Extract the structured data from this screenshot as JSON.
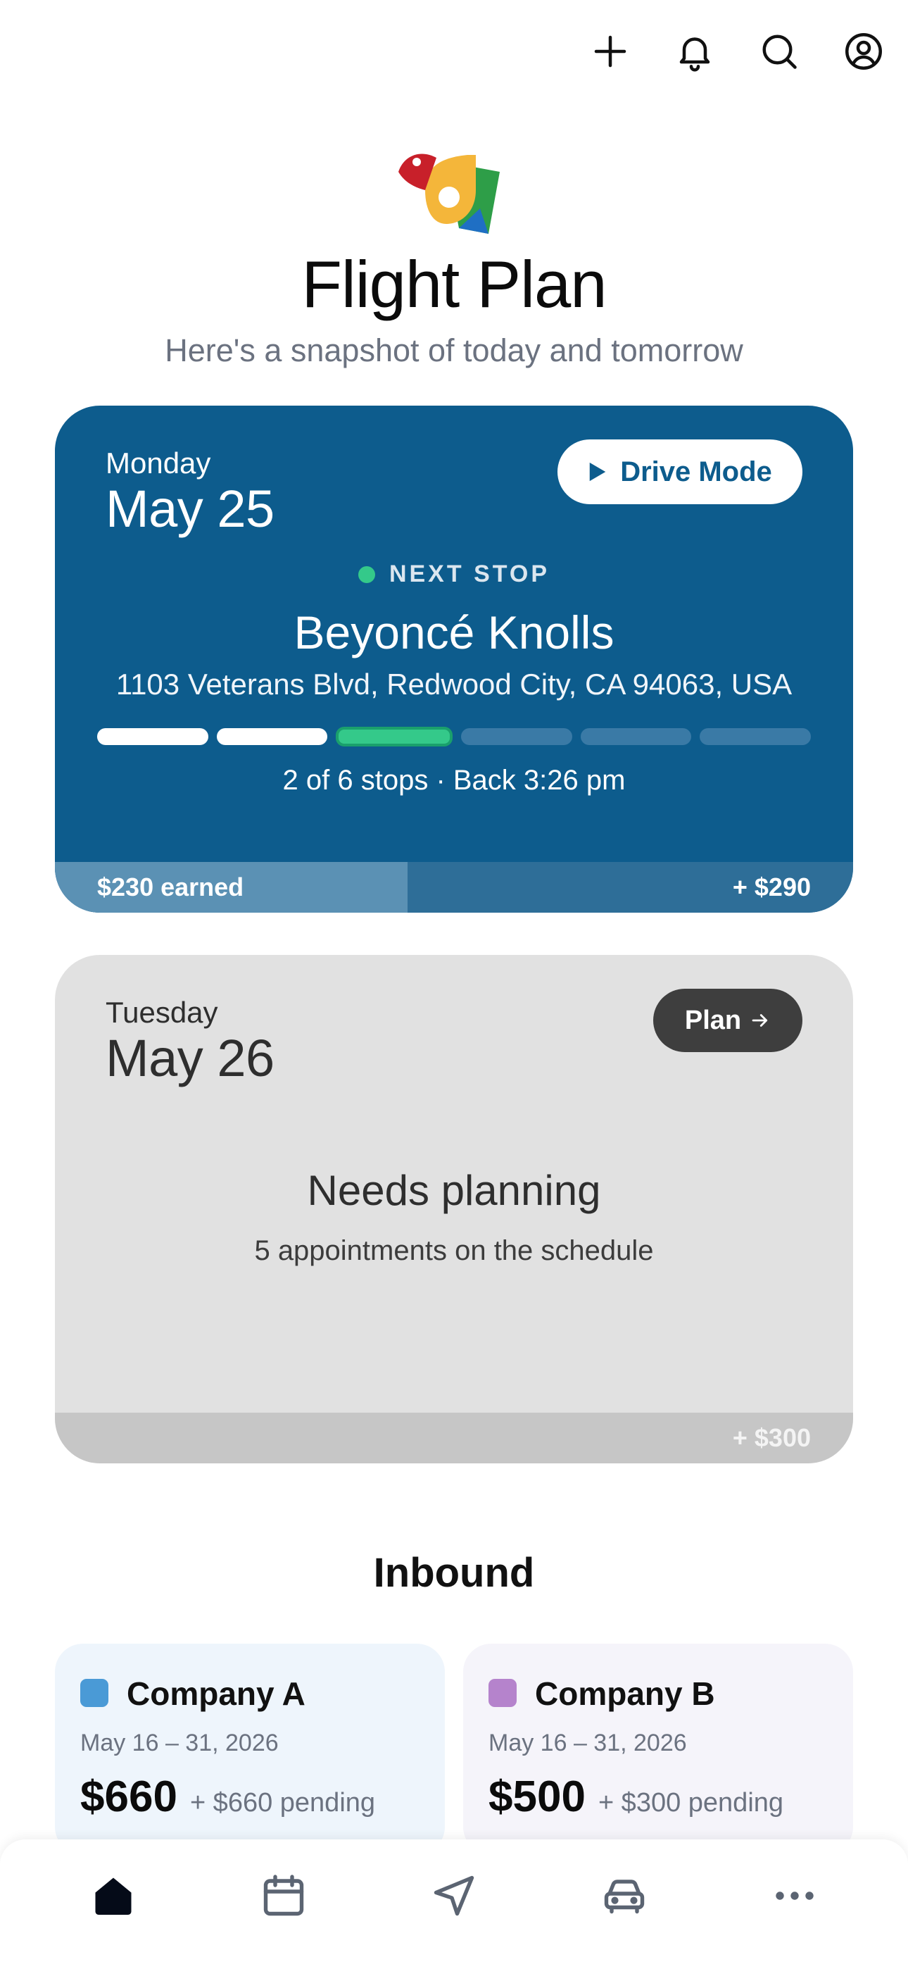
{
  "header": {
    "title": "Flight Plan",
    "subtitle": "Here's a snapshot of today and tomorrow"
  },
  "topbar": {
    "icons": [
      "plus-icon",
      "bell-icon",
      "search-icon",
      "user-circle-icon"
    ]
  },
  "today": {
    "day_name": "Monday",
    "date": "May 25",
    "drive_mode_label": "Drive Mode",
    "next_stop_label": "NEXT STOP",
    "stop_name": "Beyoncé Knolls",
    "stop_address": "1103 Veterans Blvd, Redwood City, CA 94063, USA",
    "progress": {
      "completed": 2,
      "current": 3,
      "total": 6
    },
    "stops_summary": "2 of 6 stops · Back 3:26 pm",
    "earned_label": "$230 earned",
    "remaining_label": "+ $290",
    "earned_fraction": 0.442
  },
  "tomorrow": {
    "day_name": "Tuesday",
    "date": "May 26",
    "plan_label": "Plan",
    "status_title": "Needs planning",
    "status_subtitle": "5 appointments on the schedule",
    "remaining_label": "+ $300"
  },
  "inbound": {
    "title": "Inbound",
    "companies": [
      {
        "name": "Company A",
        "dates": "May 16 – 31, 2026",
        "amount": "$660",
        "pending": "+ $660 pending",
        "color": "#4a9ad6"
      },
      {
        "name": "Company B",
        "dates": "May 16 – 31, 2026",
        "amount": "$500",
        "pending": "+ $300 pending",
        "color": "#b583cc"
      }
    ]
  },
  "bottom_nav": {
    "items": [
      "home-icon",
      "calendar-icon",
      "navigation-icon",
      "car-icon",
      "more-icon"
    ],
    "active": "home-icon"
  },
  "colors": {
    "today_card": "#0d5c8d",
    "accent_green": "#34c98a",
    "tomorrow_card": "#e1e1e1"
  }
}
